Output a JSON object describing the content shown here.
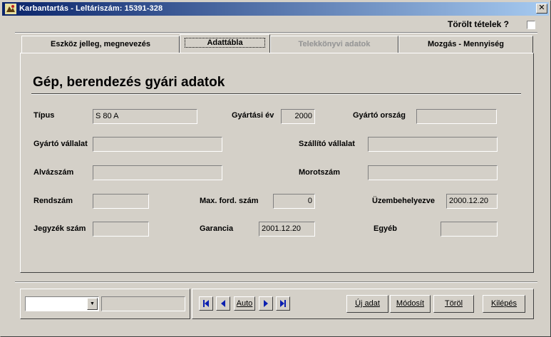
{
  "window": {
    "title": "Karbantartás - Leltáriszám:  15391-328",
    "close_symbol": "✕",
    "icon": "app-icon"
  },
  "deleted_items": {
    "label": "Törölt tételek ?",
    "checked": false
  },
  "tabs": [
    {
      "label": "Eszköz jelleg, megnevezés",
      "state": "normal"
    },
    {
      "label": "Adattábla",
      "state": "active"
    },
    {
      "label": "Telekkönyvi adatok",
      "state": "disabled"
    },
    {
      "label": "Mozgás - Mennyiség",
      "state": "normal"
    }
  ],
  "section": {
    "title": "Gép, berendezés gyári adatok"
  },
  "fields": {
    "tipus": {
      "label": "Típus",
      "value": "S 80 A"
    },
    "gyartasi_ev": {
      "label": "Gyártási év",
      "value": "2000"
    },
    "gyarto_orszag": {
      "label": "Gyártó ország",
      "value": ""
    },
    "gyarto_vallalat": {
      "label": "Gyártó vállalat",
      "value": ""
    },
    "szallito_vallalat": {
      "label": "Szállító vállalat",
      "value": ""
    },
    "alvazszam": {
      "label": "Alvázszám",
      "value": ""
    },
    "motorszam": {
      "label": "Morotszám",
      "value": ""
    },
    "rendszam": {
      "label": "Rendszám",
      "value": ""
    },
    "max_ford_szam": {
      "label": "Max. ford. szám",
      "value": "0"
    },
    "uzembehelyezve": {
      "label": "Üzembehelyezve",
      "value": "2000.12.20"
    },
    "jegyzek_szam": {
      "label": "Jegyzék szám",
      "value": ""
    },
    "garancia": {
      "label": "Garancia",
      "value": "2001.12.20"
    },
    "egyeb": {
      "label": "Egyéb",
      "value": ""
    }
  },
  "bottom": {
    "combo_value": "",
    "combo_arrow": "▼",
    "text_value": "",
    "nav": {
      "first": "first-record-icon",
      "prev": "previous-record-icon",
      "auto_label": "Auto",
      "next": "next-record-icon",
      "last": "last-record-icon"
    },
    "buttons": {
      "new": "Új adat",
      "modify": "Módosít",
      "delete": "Töröl",
      "exit": "Kilépés"
    }
  }
}
